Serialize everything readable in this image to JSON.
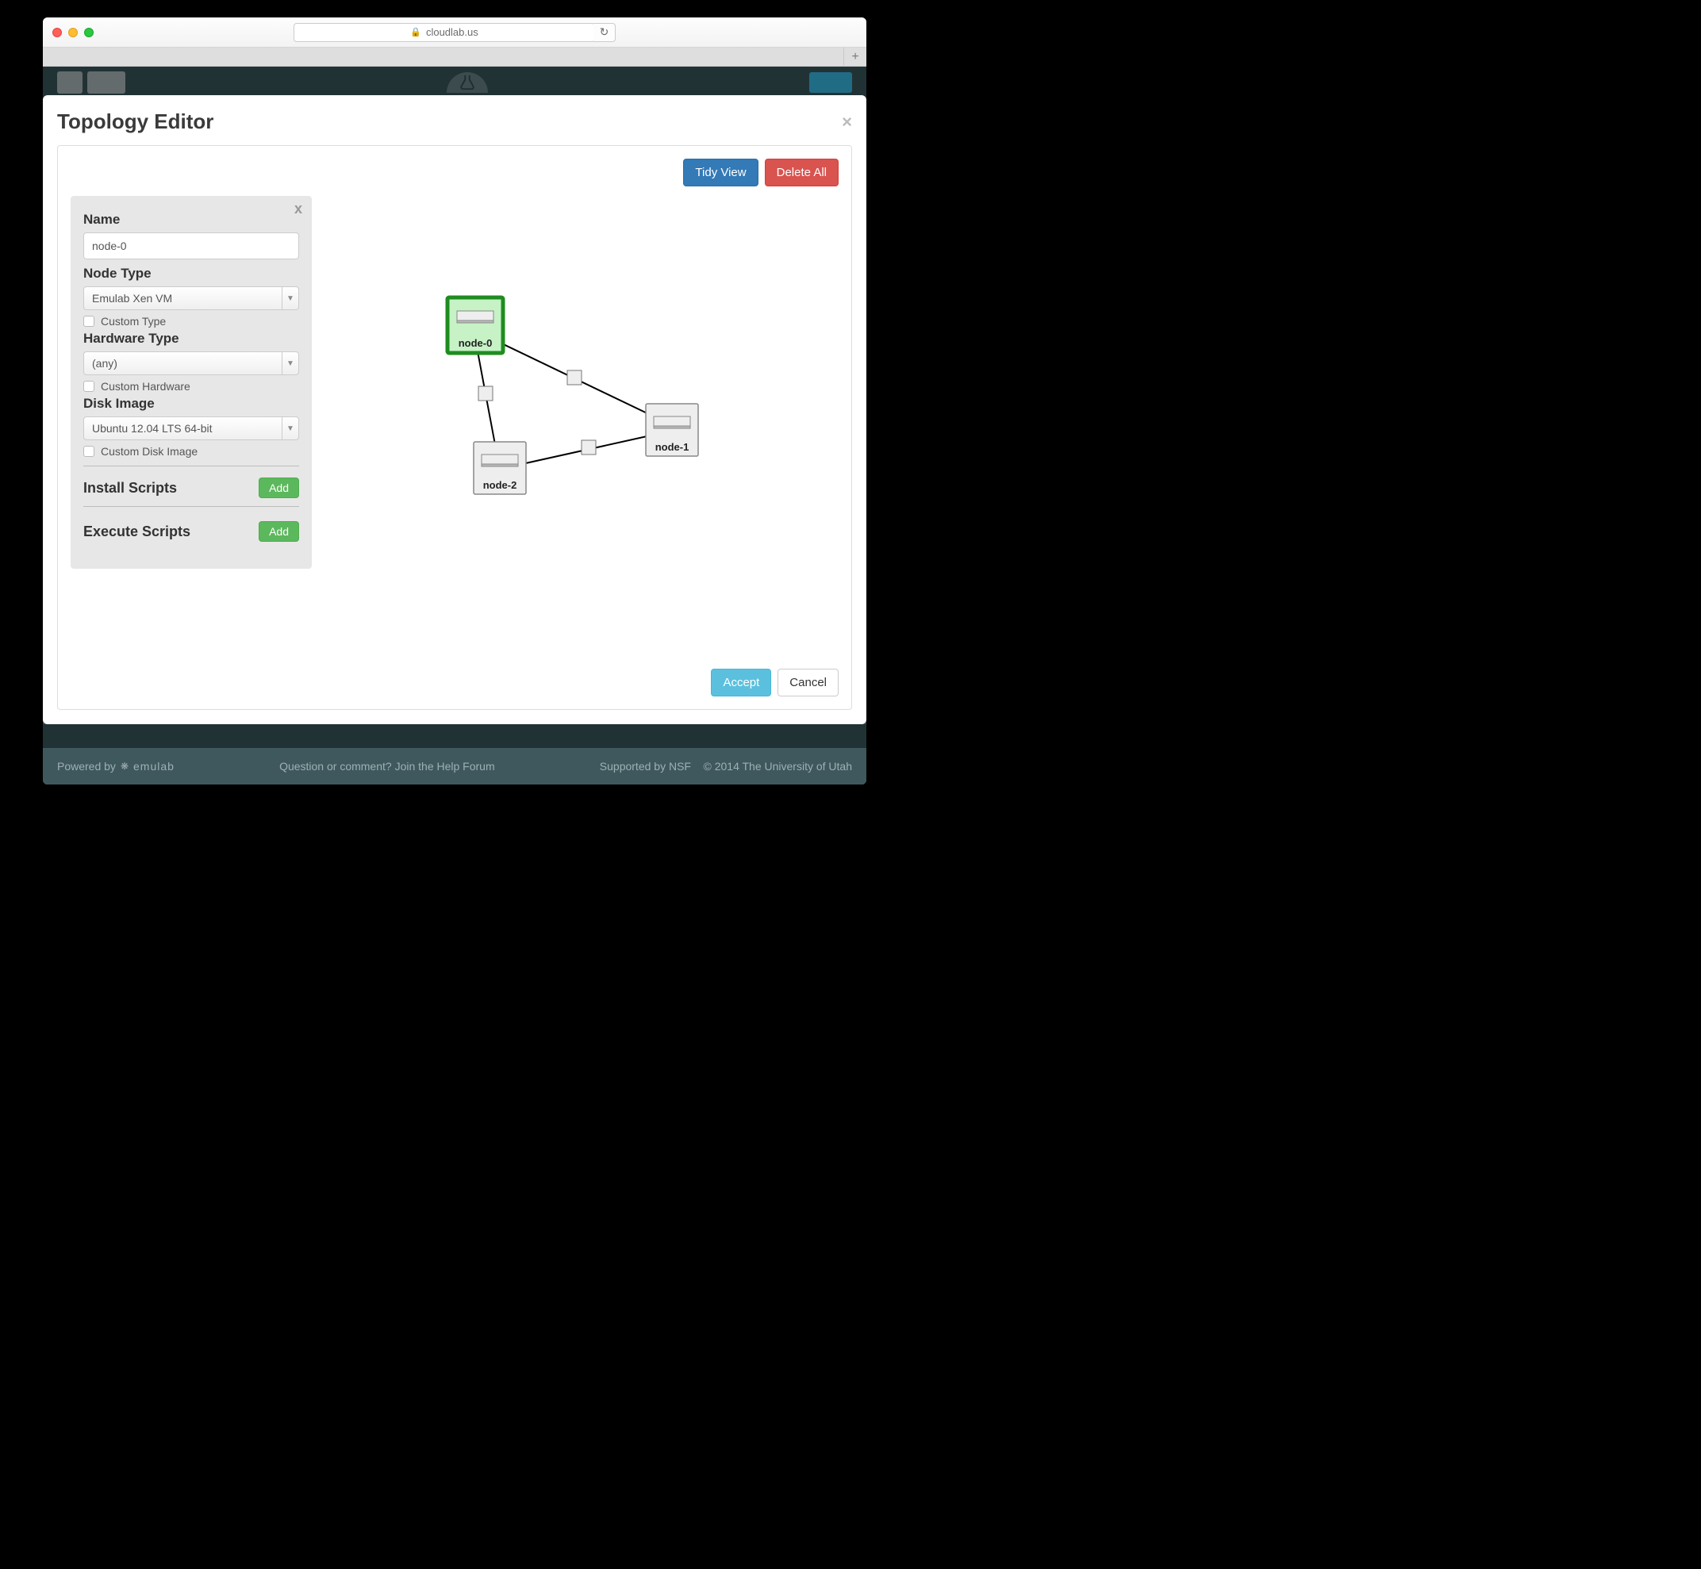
{
  "browser": {
    "url_host": "cloudlab.us"
  },
  "modal": {
    "title": "Topology Editor",
    "tidy_view": "Tidy View",
    "delete_all": "Delete All",
    "accept": "Accept",
    "cancel": "Cancel"
  },
  "properties": {
    "close": "x",
    "name_label": "Name",
    "name_value": "node-0",
    "node_type_label": "Node Type",
    "node_type_value": "Emulab Xen VM",
    "custom_type_label": "Custom Type",
    "hardware_type_label": "Hardware Type",
    "hardware_type_value": "(any)",
    "custom_hardware_label": "Custom Hardware",
    "disk_image_label": "Disk Image",
    "disk_image_value": "Ubuntu 12.04 LTS 64-bit",
    "custom_disk_image_label": "Custom Disk Image",
    "install_scripts_label": "Install Scripts",
    "install_scripts_add": "Add",
    "execute_scripts_label": "Execute Scripts",
    "execute_scripts_add": "Add"
  },
  "topology": {
    "nodes": [
      {
        "id": "node-0",
        "label": "node-0",
        "selected": true
      },
      {
        "id": "node-1",
        "label": "node-1",
        "selected": false
      },
      {
        "id": "node-2",
        "label": "node-2",
        "selected": false
      }
    ],
    "links": [
      {
        "from": "node-0",
        "to": "node-1"
      },
      {
        "from": "node-0",
        "to": "node-2"
      },
      {
        "from": "node-1",
        "to": "node-2"
      }
    ]
  },
  "footer": {
    "powered_by_prefix": "Powered by ",
    "powered_by_brand": "emulab",
    "center_prefix": "Question or comment? ",
    "center_link": "Join the Help Forum",
    "supported_by": "Supported by NSF",
    "copyright": "© 2014 The University of Utah"
  }
}
